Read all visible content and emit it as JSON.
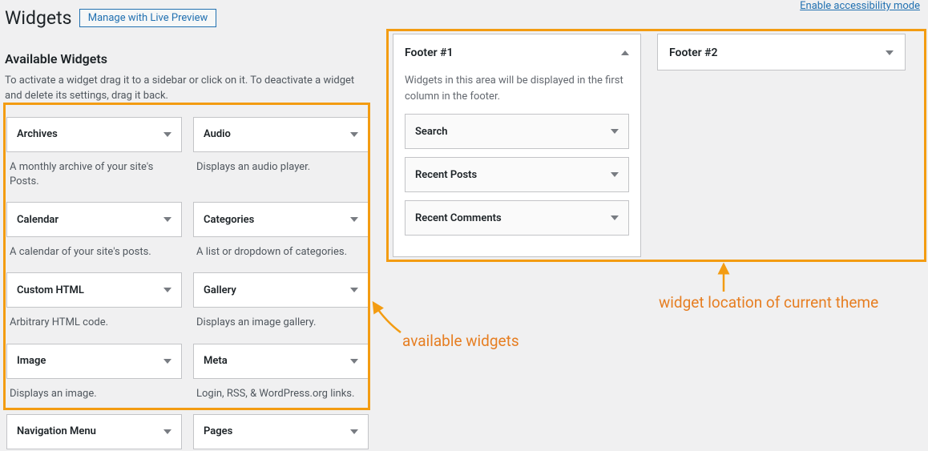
{
  "topLink": "Enable accessibility mode",
  "pageTitle": "Widgets",
  "previewBtn": "Manage with Live Preview",
  "availableTitle": "Available Widgets",
  "availableDesc": "To activate a widget drag it to a sidebar or click on it. To deactivate a widget and delete its settings, drag it back.",
  "widgets": [
    {
      "name": "Archives",
      "desc": "A monthly archive of your site's Posts."
    },
    {
      "name": "Audio",
      "desc": "Displays an audio player."
    },
    {
      "name": "Calendar",
      "desc": "A calendar of your site's posts."
    },
    {
      "name": "Categories",
      "desc": "A list or dropdown of categories."
    },
    {
      "name": "Custom HTML",
      "desc": "Arbitrary HTML code."
    },
    {
      "name": "Gallery",
      "desc": "Displays an image gallery."
    },
    {
      "name": "Image",
      "desc": "Displays an image."
    },
    {
      "name": "Meta",
      "desc": "Login, RSS, & WordPress.org links."
    },
    {
      "name": "Navigation Menu",
      "desc": ""
    },
    {
      "name": "Pages",
      "desc": ""
    }
  ],
  "footer1": {
    "title": "Footer #1",
    "desc": "Widgets in this area will be displayed in the first column in the footer.",
    "items": [
      "Search",
      "Recent Posts",
      "Recent Comments"
    ]
  },
  "footer2": {
    "title": "Footer #2"
  },
  "annot1": "available widgets",
  "annot2": "widget location of current theme"
}
